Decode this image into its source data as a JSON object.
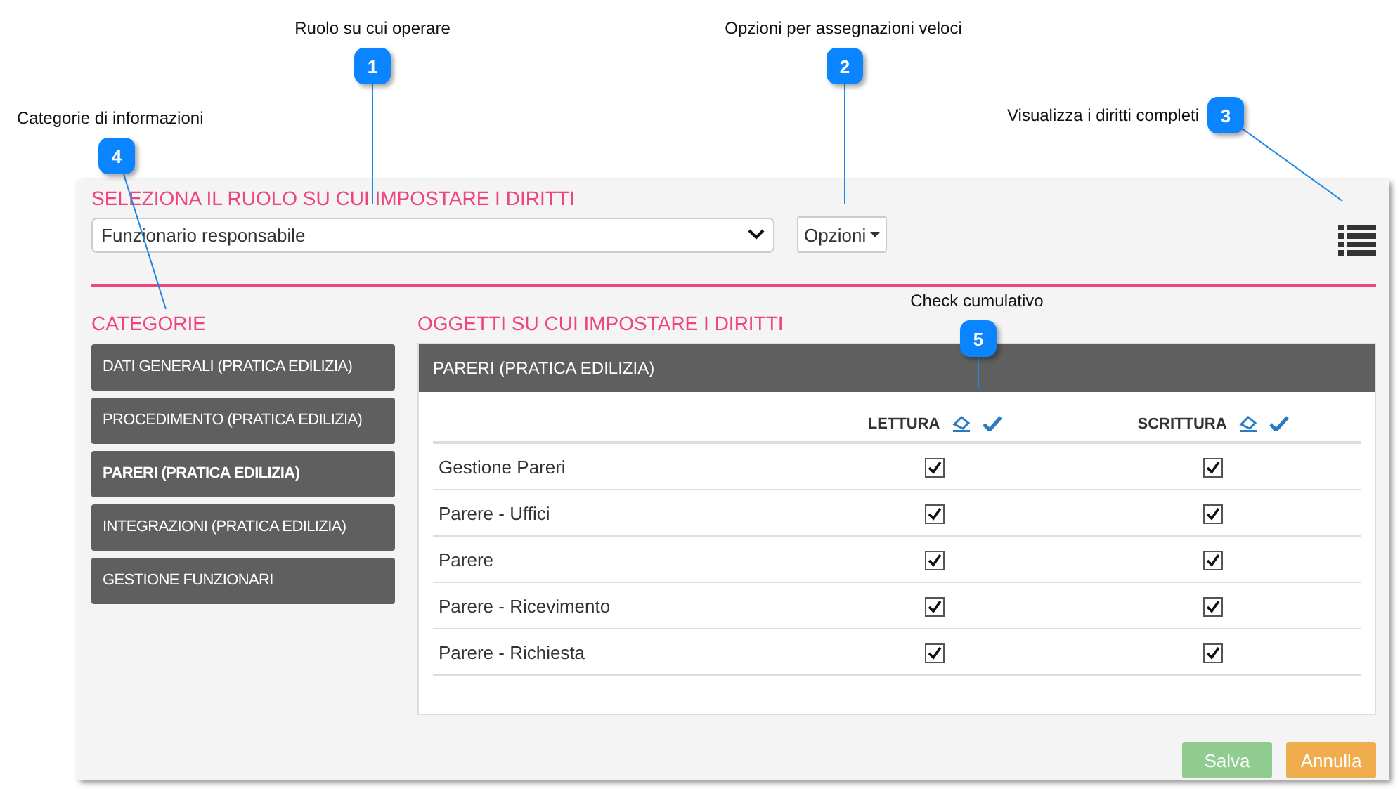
{
  "callouts": [
    {
      "number": "1",
      "label": "Ruolo su cui operare"
    },
    {
      "number": "2",
      "label": "Opzioni per assegnazioni veloci"
    },
    {
      "number": "4",
      "label": "Categorie di informazioni"
    },
    {
      "number": "3",
      "label": "Visualizza i diritti completi"
    },
    {
      "number": "5",
      "label": "Check cumulativo"
    }
  ],
  "role": {
    "heading": "SELEZIONA IL RUOLO SU CUI IMPOSTARE I DIRITTI",
    "value": "Funzionario responsabile",
    "options_button": "Opzioni"
  },
  "categories": {
    "heading": "CATEGORIE",
    "items": [
      {
        "label": "DATI GENERALI (PRATICA EDILIZIA)",
        "selected": false
      },
      {
        "label": "PROCEDIMENTO (PRATICA EDILIZIA)",
        "selected": false
      },
      {
        "label": "PARERI (PRATICA EDILIZIA)",
        "selected": true
      },
      {
        "label": "INTEGRAZIONI (PRATICA EDILIZIA)",
        "selected": false
      },
      {
        "label": "GESTIONE FUNZIONARI",
        "selected": false
      }
    ]
  },
  "objects": {
    "heading": "OGGETTI SU CUI IMPOSTARE I DIRITTI",
    "panel_title": "PARERI (PRATICA EDILIZIA)",
    "columns": [
      "LETTURA",
      "SCRITTURA"
    ],
    "rows": [
      {
        "name": "Gestione Pareri",
        "lettura": true,
        "scrittura": true
      },
      {
        "name": "Parere - Uffici",
        "lettura": true,
        "scrittura": true
      },
      {
        "name": "Parere",
        "lettura": true,
        "scrittura": true
      },
      {
        "name": "Parere - Ricevimento",
        "lettura": true,
        "scrittura": true
      },
      {
        "name": "Parere - Richiesta",
        "lettura": true,
        "scrittura": true
      }
    ]
  },
  "buttons": [
    {
      "label": "Salva",
      "kind": "save",
      "disabled": true
    },
    {
      "label": "Annulla",
      "kind": "cancel",
      "disabled": false
    }
  ]
}
